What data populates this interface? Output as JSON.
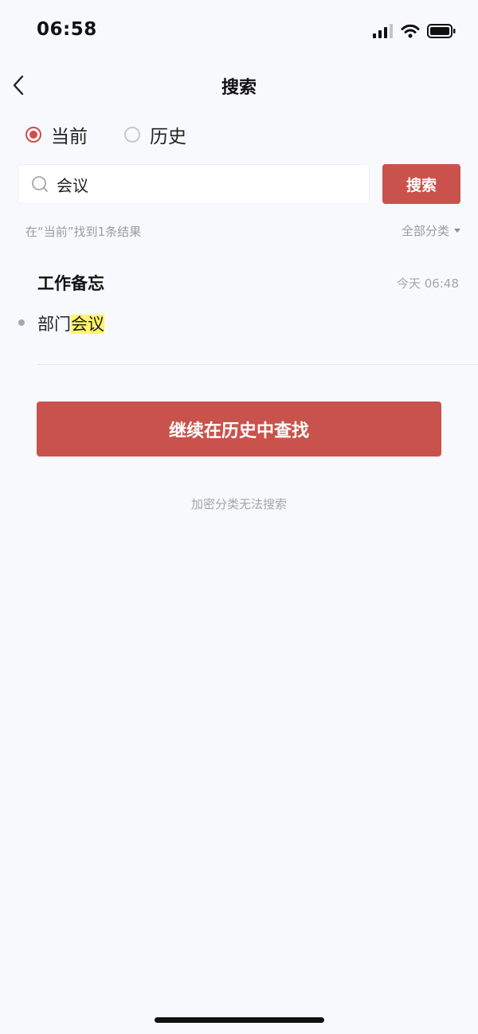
{
  "status": {
    "time": "06:58"
  },
  "nav": {
    "title": "搜索"
  },
  "scope": {
    "options": [
      {
        "label": "当前",
        "checked": true
      },
      {
        "label": "历史",
        "checked": false
      }
    ]
  },
  "search": {
    "value": "会议",
    "button": "搜索"
  },
  "results": {
    "count_text": "在“当前”找到1条结果",
    "category": "全部分类"
  },
  "note": {
    "title": "工作备忘",
    "time": "今天 06:48",
    "line_prefix": "部门",
    "line_highlight": "会议"
  },
  "actions": {
    "continue_label": "继续在历史中查找",
    "hint": "加密分类无法搜索"
  },
  "colors": {
    "accent": "#c9534c",
    "highlight": "#fff46a"
  },
  "icons": [
    "cellular-signal-icon",
    "wifi-icon",
    "battery-icon",
    "back-arrow-icon",
    "search-icon",
    "caret-down-icon"
  ]
}
